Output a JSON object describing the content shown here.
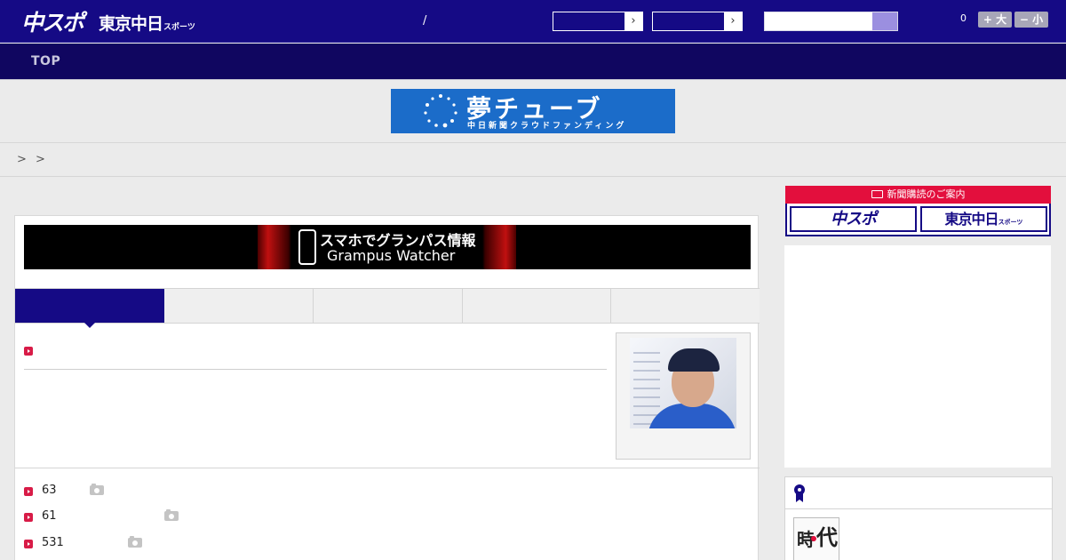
{
  "header": {
    "logo_chuspo": "中スポ",
    "logo_tokyo": "東京中日",
    "logo_tokyo_small": "スポーツ",
    "separator": "/",
    "select1_arrow": "›",
    "select2_arrow": "›",
    "search_placeholder": "",
    "font_size_label": "0",
    "font_bigger": "+ 大",
    "font_smaller": "− 小"
  },
  "nav": {
    "top": "TOP"
  },
  "banner": {
    "title": "夢チューブ",
    "subtitle": "中日新聞クラウドファンディング"
  },
  "breadcrumb": "> >",
  "promo": {
    "line1": "スマホでグランパス情報",
    "line2": "Grampus Watcher"
  },
  "news_items": [
    {
      "num": "63"
    },
    {
      "num": "61"
    },
    {
      "num": "531"
    }
  ],
  "subscribe": {
    "header": "新聞購読のご案内",
    "btn_chuspo": "中スポ",
    "btn_tokyo": "東京中日",
    "btn_tokyo_small": "スポーツ"
  },
  "ranking": {
    "thumb_k1": "時",
    "thumb_k2": "代"
  },
  "colors": {
    "brand": "#150a85",
    "nav": "#100660",
    "accent": "#e30f3d",
    "bullet": "#d81b47"
  }
}
